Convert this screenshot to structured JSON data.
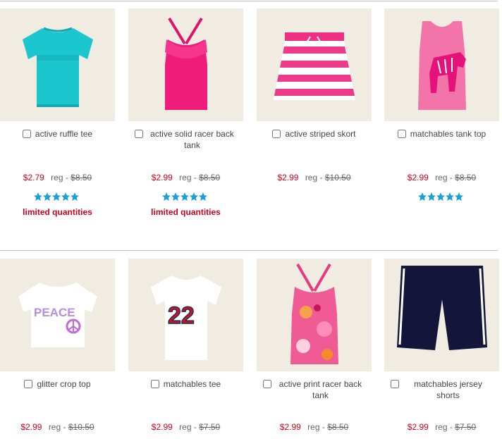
{
  "products": [
    {
      "name": "active ruffle tee",
      "sale": "$2.79",
      "reg_label": "reg -",
      "orig": "$8.50",
      "rating": 5,
      "note": "limited quantities",
      "image": "teal-ruffle-tee"
    },
    {
      "name": "active solid racer back tank",
      "sale": "$2.99",
      "reg_label": "reg -",
      "orig": "$8.50",
      "rating": 5,
      "note": "limited quantities",
      "image": "pink-racer-tank"
    },
    {
      "name": "active striped skort",
      "sale": "$2.99",
      "reg_label": "reg -",
      "orig": "$10.50",
      "image": "striped-skort"
    },
    {
      "name": "matchables tank top",
      "sale": "$2.99",
      "reg_label": "reg -",
      "orig": "$8.50",
      "rating": 5,
      "image": "zebra-tank"
    },
    {
      "name": "glitter crop top",
      "sale": "$2.99",
      "reg_label": "reg -",
      "orig": "$10.50",
      "image": "peace-crop-top"
    },
    {
      "name": "matchables tee",
      "sale": "$2.99",
      "reg_label": "reg -",
      "orig": "$7.50",
      "image": "22-tee"
    },
    {
      "name": "active print racer back tank",
      "sale": "$2.99",
      "reg_label": "reg -",
      "orig": "$8.50",
      "image": "floral-racer-tank"
    },
    {
      "name": "matchables jersey shorts",
      "sale": "$2.99",
      "reg_label": "reg -",
      "orig": "$7.50",
      "image": "navy-jersey-shorts"
    }
  ],
  "colors": {
    "sale": "#d0021b",
    "star": "#1aa0d8",
    "thumb_bg": "#f1ece1"
  }
}
